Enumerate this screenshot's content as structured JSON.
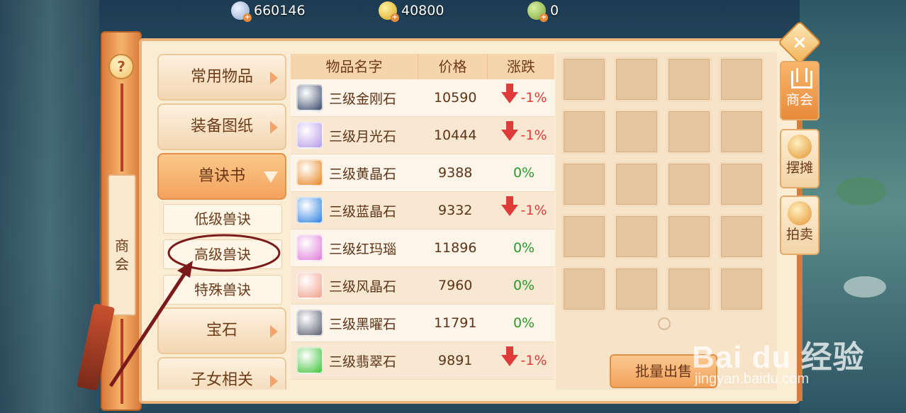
{
  "currencies": [
    {
      "icon": "silver-coin-icon",
      "value": "660146"
    },
    {
      "icon": "gold-coin-icon",
      "value": "40800"
    },
    {
      "icon": "jade-coin-icon",
      "value": "0"
    }
  ],
  "left_tab": {
    "label": "商会",
    "help": "?"
  },
  "categories": {
    "common": "常用物品",
    "equipment": "装备图纸",
    "beast_book": "兽诀书",
    "sub_low": "低级兽诀",
    "sub_high": "高级兽诀",
    "sub_special": "特殊兽诀",
    "gem": "宝石",
    "children": "子女相关"
  },
  "table": {
    "headers": {
      "name": "物品名字",
      "price": "价格",
      "change": "涨跌"
    },
    "rows": [
      {
        "name": "三级金刚石",
        "price": "10590",
        "change": "-1%",
        "trend": "down",
        "color": "#3a4a6a"
      },
      {
        "name": "三级月光石",
        "price": "10444",
        "change": "-1%",
        "trend": "down",
        "color": "#b59ae8"
      },
      {
        "name": "三级黄晶石",
        "price": "9388",
        "change": "0%",
        "trend": "flat",
        "color": "#e8841e"
      },
      {
        "name": "三级蓝晶石",
        "price": "9332",
        "change": "-1%",
        "trend": "down",
        "color": "#2e7fe0"
      },
      {
        "name": "三级红玛瑙",
        "price": "11896",
        "change": "0%",
        "trend": "flat",
        "color": "#e07ad8"
      },
      {
        "name": "三级风晶石",
        "price": "7960",
        "change": "0%",
        "trend": "flat",
        "color": "#f0a08a"
      },
      {
        "name": "三级黑曜石",
        "price": "11791",
        "change": "0%",
        "trend": "flat",
        "color": "#5a5f70"
      },
      {
        "name": "三级翡翠石",
        "price": "9891",
        "change": "-1%",
        "trend": "down",
        "color": "#3ec23a"
      }
    ]
  },
  "sell_button": "批量出售",
  "side_tabs": {
    "shop": "商会",
    "stall": "摆摊",
    "auction": "拍卖"
  },
  "close_icon": "close-icon",
  "watermark": {
    "logo": "Bai du 经验",
    "url": "jingyan.baidu.com"
  }
}
